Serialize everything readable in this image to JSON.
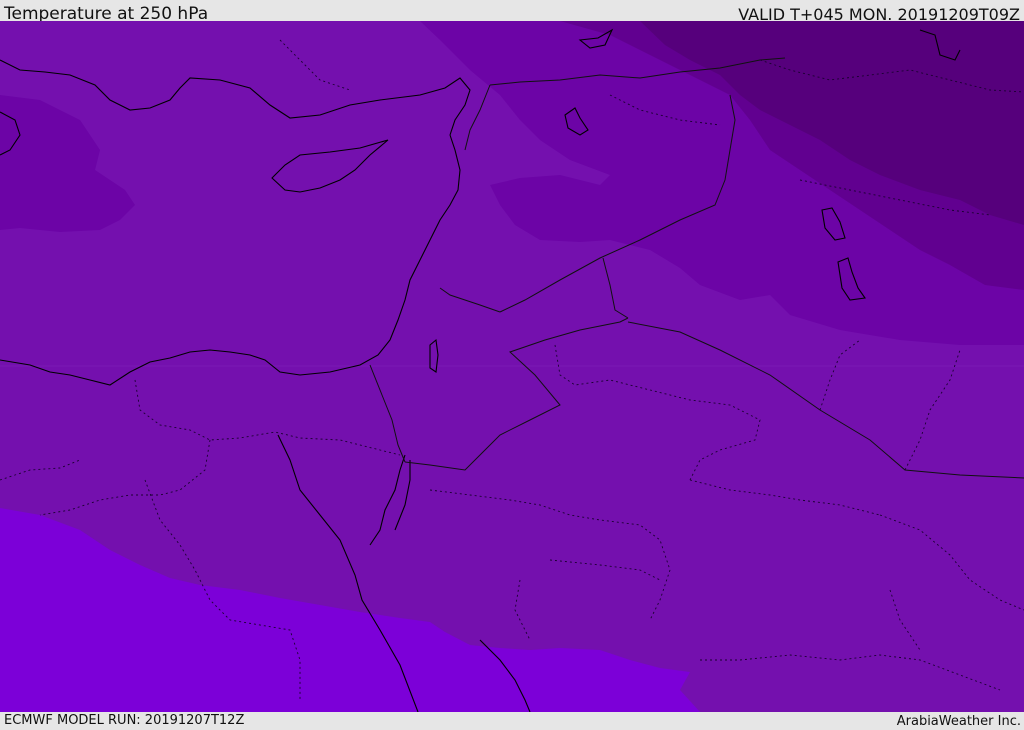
{
  "header": {
    "title": "Temperature at 250 hPa",
    "valid": "VALID T+045 MON. 20191209T09Z"
  },
  "footer": {
    "model_run": "ECMWF MODEL RUN: 20191207T12Z",
    "brand": "ArabiaWeather Inc."
  },
  "map": {
    "field": "temperature",
    "level": "250 hPa",
    "colors": {
      "base": "#7410ae",
      "warm_south": "#7c00d8",
      "cold_1": "#6c04a6",
      "cold_2": "#610090",
      "cold_3": "#56007c",
      "coastline": "#000000",
      "border": "#1a0030"
    }
  }
}
